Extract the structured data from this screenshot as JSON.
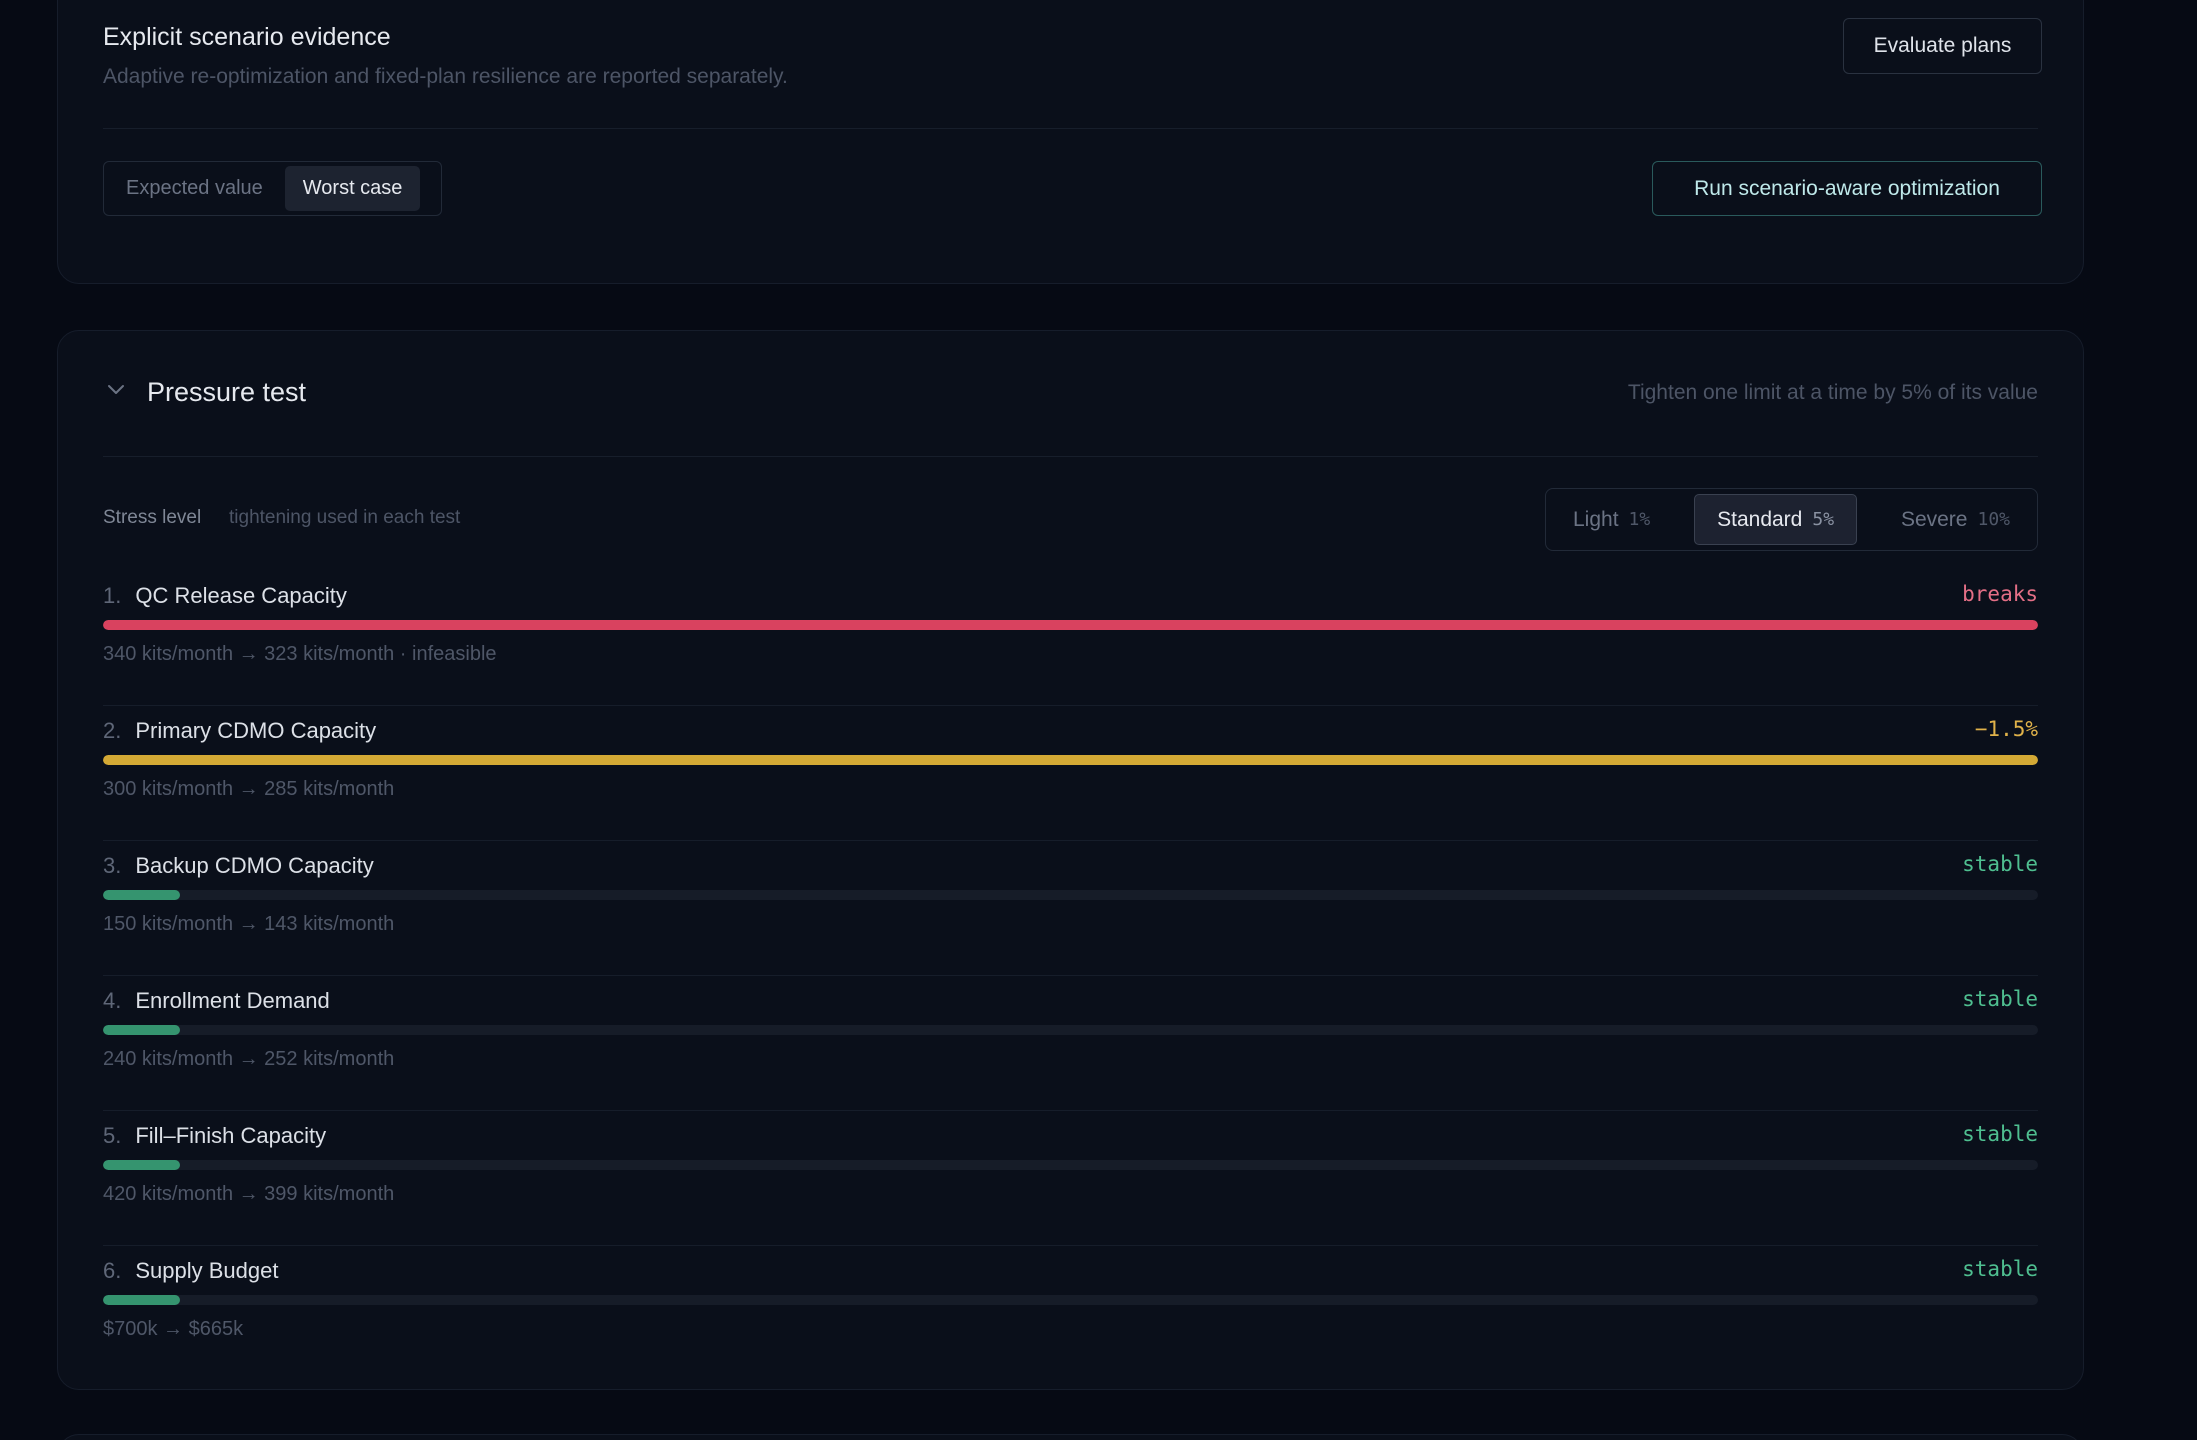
{
  "evidence": {
    "title": "Explicit scenario evidence",
    "subtitle": "Adaptive re-optimization and fixed-plan resilience are reported separately.",
    "evaluate_label": "Evaluate plans",
    "run_label": "Run scenario-aware optimization",
    "modes": [
      {
        "label": "Expected value",
        "active": false
      },
      {
        "label": "Worst case",
        "active": true
      }
    ]
  },
  "pressure": {
    "title": "Pressure test",
    "hint": "Tighten one limit at a time by 5% of its value",
    "stress_label": "Stress level",
    "stress_sub": "tightening used in each test",
    "levels": [
      {
        "label": "Light",
        "pct": "1%",
        "active": false
      },
      {
        "label": "Standard",
        "pct": "5%",
        "active": true
      },
      {
        "label": "Severe",
        "pct": "10%",
        "active": false
      }
    ],
    "rows": [
      {
        "num": "1.",
        "name": "QC Release Capacity",
        "status": "breaks",
        "detail": "340 kits/month → 323 kits/month · infeasible",
        "level": 1.0,
        "color": "#d9425f",
        "status_color": "#e46f86"
      },
      {
        "num": "2.",
        "name": "Primary CDMO Capacity",
        "status": "−1.5%",
        "detail": "300 kits/month → 285 kits/month",
        "level": 1.0,
        "color": "#d4a935",
        "status_color": "#e0b24a"
      },
      {
        "num": "3.",
        "name": "Backup CDMO Capacity",
        "status": "stable",
        "detail": "150 kits/month → 143 kits/month",
        "level": 0.04,
        "color": "#35946f",
        "status_color": "#4fbf90"
      },
      {
        "num": "4.",
        "name": "Enrollment Demand",
        "status": "stable",
        "detail": "240 kits/month → 252 kits/month",
        "level": 0.04,
        "color": "#35946f",
        "status_color": "#4fbf90"
      },
      {
        "num": "5.",
        "name": "Fill–Finish Capacity",
        "status": "stable",
        "detail": "420 kits/month → 399 kits/month",
        "level": 0.04,
        "color": "#35946f",
        "status_color": "#4fbf90"
      },
      {
        "num": "6.",
        "name": "Supply Budget",
        "status": "stable",
        "detail": "$700k → $665k",
        "level": 0.04,
        "color": "#35946f",
        "status_color": "#4fbf90"
      }
    ]
  }
}
